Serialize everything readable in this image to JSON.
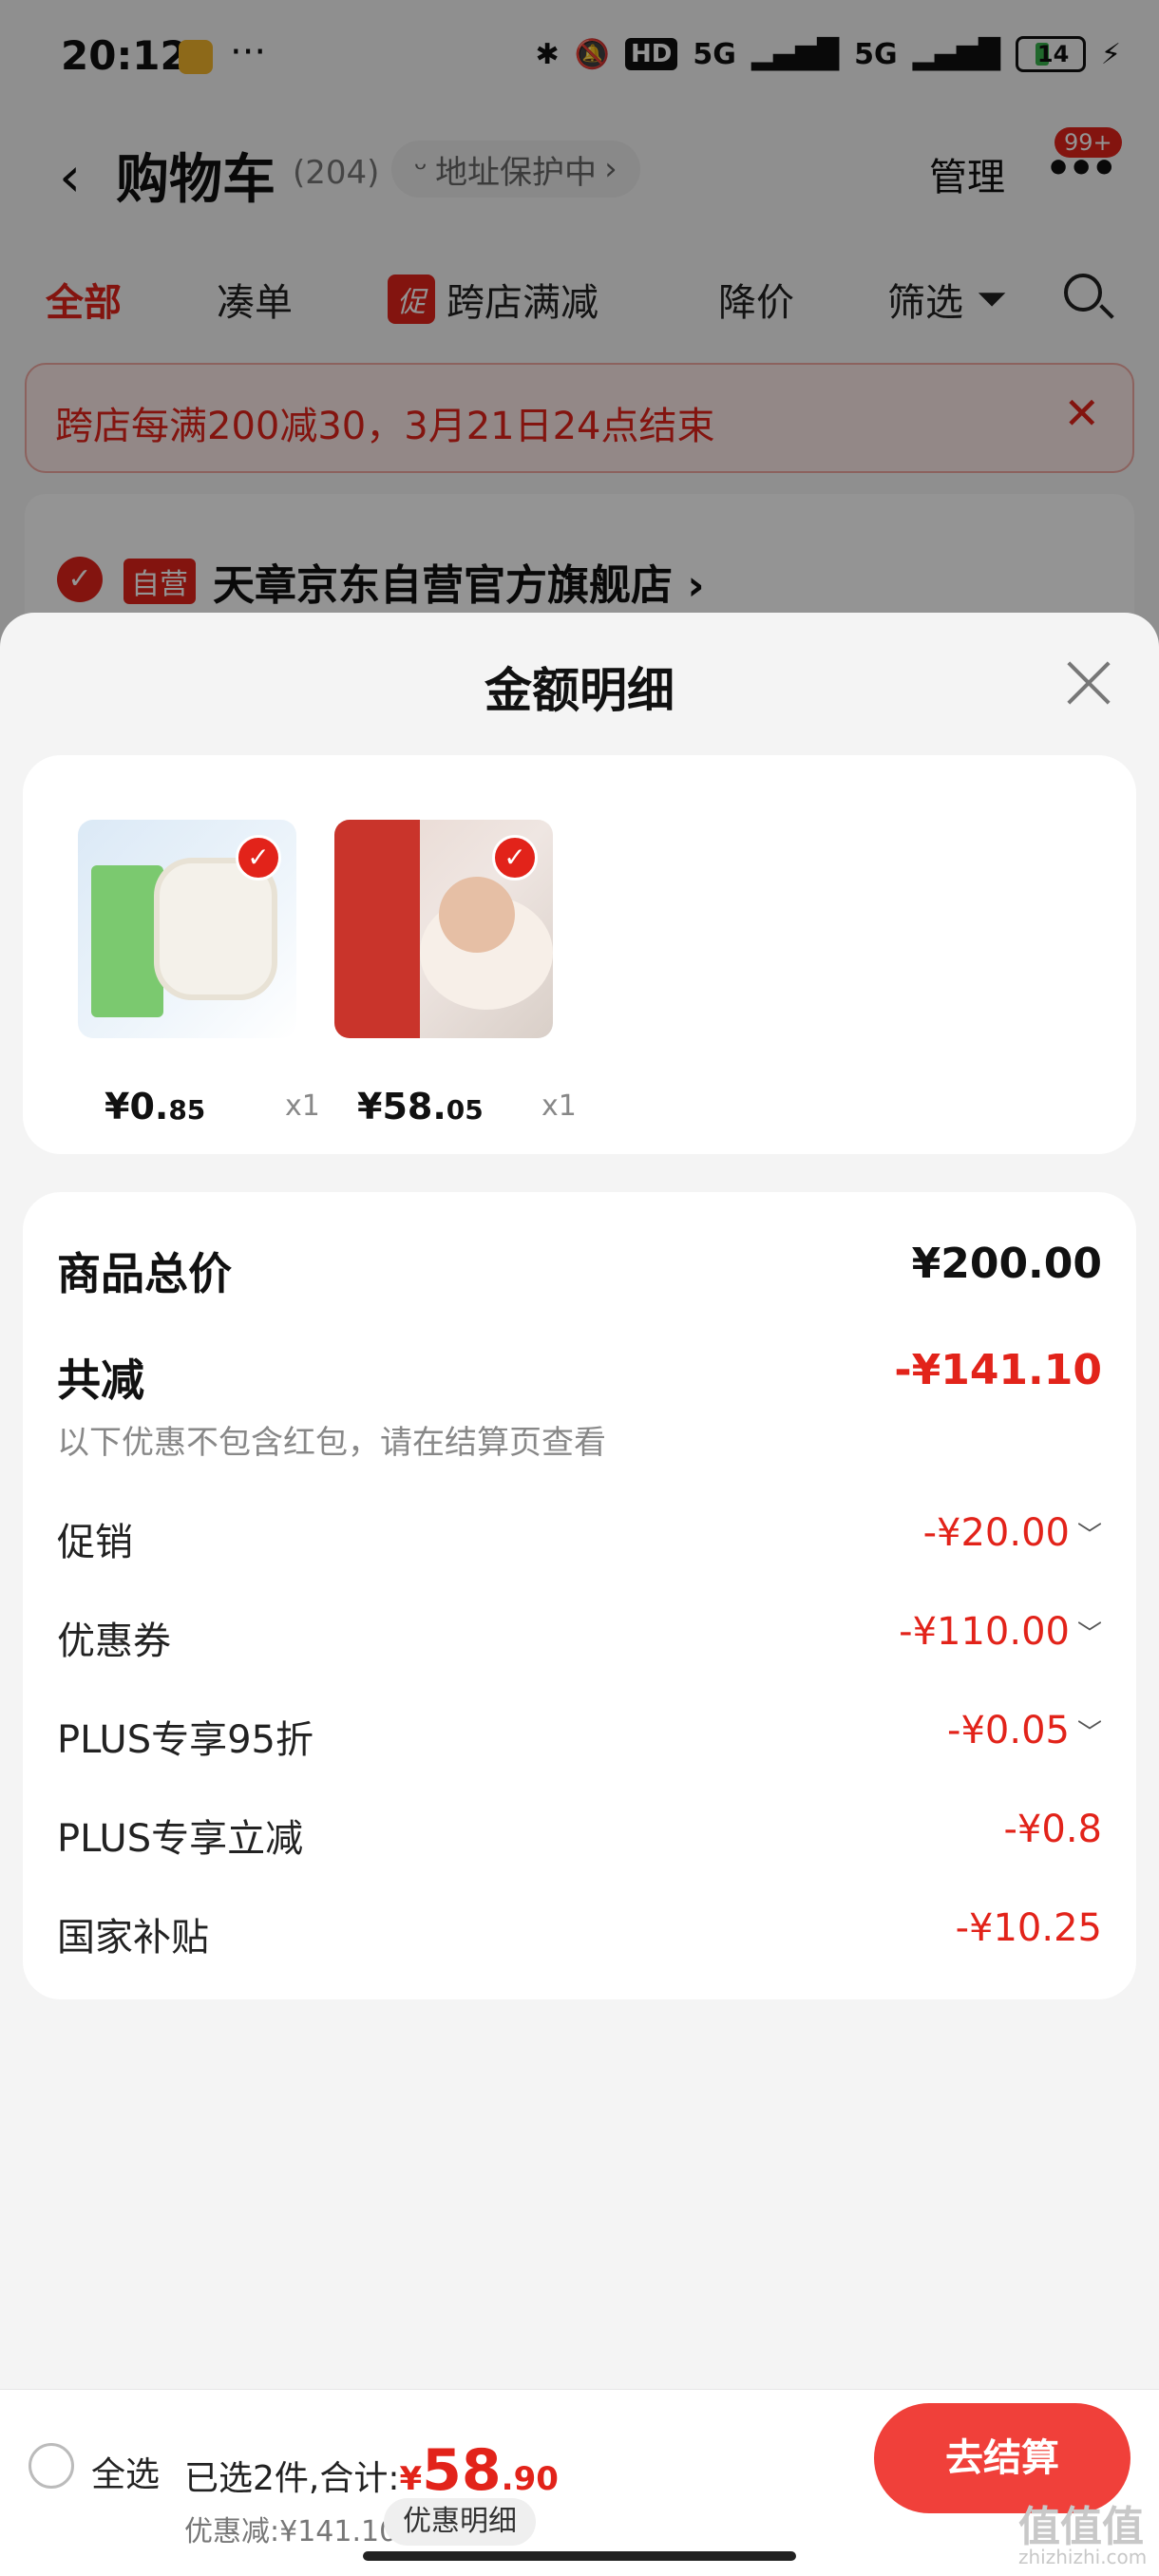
{
  "status_bar": {
    "time": "20:12",
    "dots": "···",
    "hd": "HD",
    "net1": "5G",
    "net2": "5G",
    "battery": "14"
  },
  "cart_header": {
    "title": "购物车",
    "count": "(204)",
    "address_label": "地址保护中",
    "manage_label": "管理",
    "message_badge": "99+"
  },
  "filter_tabs": {
    "all": "全部",
    "cou": "凑单",
    "promo_tag": "促",
    "promo_label": "跨店满减",
    "price_drop": "降价",
    "filter": "筛选"
  },
  "promo_banner": {
    "text": "跨店每满200减30，3月21日24点结束"
  },
  "store": {
    "tag": "自营",
    "name": "天章京东自营官方旗舰店"
  },
  "sheet": {
    "title": "金额明细",
    "products": [
      {
        "price_int": "¥0.",
        "price_dec": "85",
        "qty": "x1"
      },
      {
        "price_int": "¥58.",
        "price_dec": "05",
        "qty": "x1"
      }
    ],
    "summary": {
      "total_label": "商品总价",
      "total_value": "¥200.00",
      "reduce_label": "共减",
      "reduce_value": "-¥141.10",
      "reduce_note": "以下优惠不包含红包，请在结算页查看",
      "items": [
        {
          "label": "促销",
          "value": "-¥20.00"
        },
        {
          "label": "优惠券",
          "value": "-¥110.00"
        },
        {
          "label": "PLUS专享95折",
          "value": "-¥0.05"
        },
        {
          "label": "PLUS专享立减",
          "value": "-¥0.8"
        },
        {
          "label": "国家补贴",
          "value": "-¥10.25"
        }
      ]
    }
  },
  "bottom_bar": {
    "select_all": "全选",
    "selected_text": "已选2件,合计:",
    "total_currency": "¥",
    "total_int": "58",
    "total_dec": ".90",
    "discount_text": "优惠减:¥141.10",
    "detail_label": "优惠明细",
    "checkout_label": "去结算",
    "watermark": "值值值",
    "watermark_sub": "zhizhizhi.com"
  },
  "colors": {
    "accent": "#e2231a",
    "checkout": "#f0403a"
  }
}
